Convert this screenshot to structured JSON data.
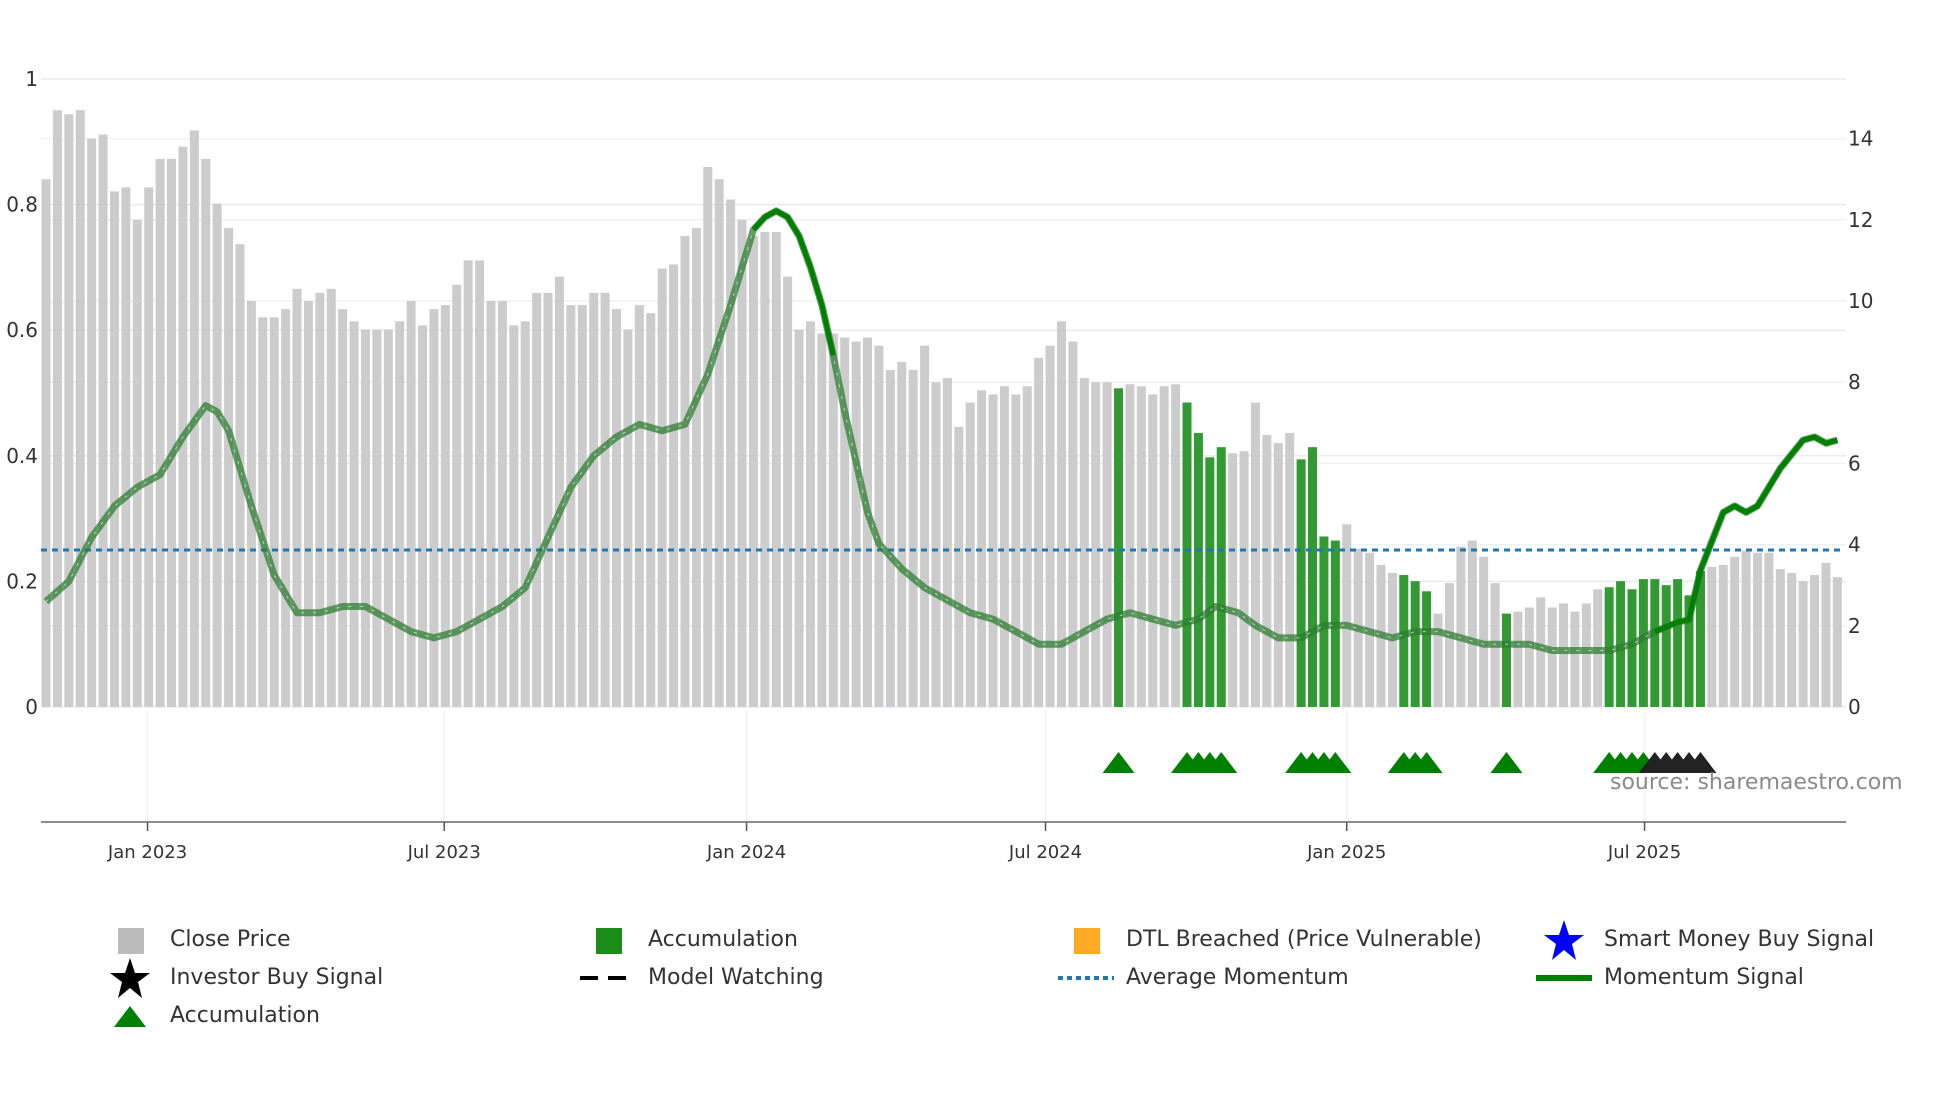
{
  "chart_data": {
    "type": "bar",
    "title": "",
    "source_note": "source: sharemaestro.com",
    "left_axis": {
      "range": [
        0,
        1
      ],
      "ticks": [
        "0",
        "0.2",
        "0.4",
        "0.6",
        "0.8",
        "1"
      ],
      "tick_values": [
        0,
        0.2,
        0.4,
        0.6,
        0.8,
        1
      ]
    },
    "right_axis": {
      "range": [
        0,
        14
      ],
      "ticks": [
        "0",
        "2",
        "4",
        "6",
        "8",
        "10",
        "12",
        "14"
      ],
      "tick_values": [
        0,
        2,
        4,
        6,
        8,
        10,
        12,
        14
      ]
    },
    "x_axis": {
      "ticks": [
        "Jan 2023",
        "Jul 2023",
        "Jan 2024",
        "Jul 2024",
        "Jan 2025",
        "Jul 2025"
      ],
      "tick_week_index": [
        8.9,
        34.9,
        61.4,
        87.6,
        114.0,
        140.1
      ],
      "grid": true
    },
    "close_price": [
      13.0,
      14.7,
      14.6,
      14.7,
      14.0,
      14.1,
      12.7,
      12.8,
      12.0,
      12.8,
      13.5,
      13.5,
      13.8,
      14.2,
      13.5,
      12.4,
      11.8,
      11.4,
      10.0,
      9.6,
      9.6,
      9.8,
      10.3,
      10.0,
      10.2,
      10.3,
      9.8,
      9.5,
      9.3,
      9.3,
      9.3,
      9.5,
      10.0,
      9.4,
      9.8,
      9.9,
      10.4,
      11.0,
      11.0,
      10.0,
      10.0,
      9.4,
      9.5,
      10.2,
      10.2,
      10.6,
      9.9,
      9.9,
      10.2,
      10.2,
      9.8,
      9.3,
      9.9,
      9.7,
      10.8,
      10.9,
      11.6,
      11.8,
      13.3,
      13.0,
      12.5,
      12.0,
      11.6,
      11.7,
      11.7,
      10.6,
      9.3,
      9.5,
      9.2,
      9.2,
      9.1,
      9.0,
      9.1,
      8.9,
      8.3,
      8.5,
      8.3,
      8.9,
      8.0,
      8.1,
      6.9,
      7.5,
      7.8,
      7.7,
      7.9,
      7.7,
      7.9,
      8.6,
      8.9,
      9.5,
      9.0,
      8.1,
      8.0,
      8.0,
      7.85,
      7.95,
      7.9,
      7.7,
      7.9,
      7.95,
      7.5,
      6.75,
      6.15,
      6.4,
      6.25,
      6.3,
      7.5,
      6.7,
      6.5,
      6.75,
      6.1,
      6.4,
      4.2,
      4.1,
      4.5,
      3.9,
      3.8,
      3.5,
      3.3,
      3.25,
      3.1,
      2.85,
      2.3,
      3.05,
      3.95,
      4.1,
      3.7,
      3.05,
      2.3,
      2.35,
      2.45,
      2.7,
      2.45,
      2.55,
      2.35,
      2.55,
      2.9,
      2.95,
      3.1,
      2.9,
      3.15,
      3.15,
      3.0,
      3.15,
      2.75,
      3.35,
      3.45,
      3.5,
      3.7,
      3.85,
      3.8,
      3.8,
      3.4,
      3.3,
      3.1,
      3.25,
      3.55,
      3.2
    ],
    "accumulation_weeks": [
      94,
      100,
      101,
      102,
      103,
      110,
      111,
      112,
      113,
      119,
      120,
      121,
      128,
      137,
      138,
      139,
      140,
      141,
      142,
      143,
      144,
      145
    ],
    "accumulation_markers": [
      94,
      100,
      101,
      102,
      103,
      110,
      111,
      112,
      113,
      119,
      120,
      121,
      128,
      137,
      138,
      139,
      140
    ],
    "investor_buy_markers": [
      141,
      142,
      143,
      144,
      145
    ],
    "momentum_signal": [
      [
        0,
        0.168
      ],
      [
        2,
        0.2
      ],
      [
        4,
        0.27
      ],
      [
        6,
        0.32
      ],
      [
        8,
        0.35
      ],
      [
        10,
        0.37
      ],
      [
        12,
        0.43
      ],
      [
        14,
        0.48
      ],
      [
        15,
        0.47
      ],
      [
        16,
        0.44
      ],
      [
        18,
        0.32
      ],
      [
        20,
        0.21
      ],
      [
        22,
        0.15
      ],
      [
        24,
        0.15
      ],
      [
        26,
        0.16
      ],
      [
        28,
        0.16
      ],
      [
        30,
        0.14
      ],
      [
        32,
        0.12
      ],
      [
        34,
        0.11
      ],
      [
        36,
        0.12
      ],
      [
        38,
        0.14
      ],
      [
        40,
        0.16
      ],
      [
        42,
        0.19
      ],
      [
        44,
        0.27
      ],
      [
        46,
        0.35
      ],
      [
        48,
        0.4
      ],
      [
        50,
        0.43
      ],
      [
        52,
        0.45
      ],
      [
        54,
        0.44
      ],
      [
        56,
        0.45
      ],
      [
        58,
        0.53
      ],
      [
        60,
        0.64
      ],
      [
        62,
        0.76
      ],
      [
        63,
        0.78
      ],
      [
        64,
        0.79
      ],
      [
        65,
        0.78
      ],
      [
        66,
        0.75
      ],
      [
        67,
        0.7
      ],
      [
        68,
        0.64
      ],
      [
        69,
        0.56
      ],
      [
        70,
        0.47
      ],
      [
        71,
        0.39
      ],
      [
        72,
        0.31
      ],
      [
        73,
        0.26
      ],
      [
        75,
        0.22
      ],
      [
        77,
        0.19
      ],
      [
        79,
        0.17
      ],
      [
        81,
        0.15
      ],
      [
        83,
        0.14
      ],
      [
        85,
        0.12
      ],
      [
        87,
        0.1
      ],
      [
        89,
        0.1
      ],
      [
        91,
        0.12
      ],
      [
        93,
        0.14
      ],
      [
        95,
        0.15
      ],
      [
        97,
        0.14
      ],
      [
        99,
        0.13
      ],
      [
        101,
        0.14
      ],
      [
        102.5,
        0.16
      ],
      [
        104.5,
        0.15
      ],
      [
        106,
        0.13
      ],
      [
        108,
        0.11
      ],
      [
        110,
        0.11
      ],
      [
        112,
        0.13
      ],
      [
        114,
        0.13
      ],
      [
        116,
        0.12
      ],
      [
        118,
        0.11
      ],
      [
        120,
        0.12
      ],
      [
        122,
        0.12
      ],
      [
        124,
        0.11
      ],
      [
        126,
        0.1
      ],
      [
        128,
        0.1
      ],
      [
        130,
        0.1
      ],
      [
        132,
        0.09
      ],
      [
        134,
        0.09
      ],
      [
        135,
        0.09
      ],
      [
        137,
        0.09
      ],
      [
        139,
        0.1
      ],
      [
        141,
        0.12
      ],
      [
        143,
        0.135
      ],
      [
        144,
        0.139
      ],
      [
        145,
        0.218
      ],
      [
        147,
        0.31
      ],
      [
        148,
        0.32
      ],
      [
        149,
        0.31
      ],
      [
        150,
        0.32
      ],
      [
        152,
        0.38
      ],
      [
        154,
        0.425
      ],
      [
        155,
        0.43
      ],
      [
        156,
        0.42
      ],
      [
        157,
        0.425
      ]
    ],
    "momentum_highlight_ranges": [
      [
        61,
        69
      ],
      [
        141,
        157
      ]
    ],
    "average_momentum": 0.25,
    "colors": {
      "close": "#cccccc",
      "accumulation": "#339933",
      "momentum": "#008000",
      "average": "#1f77b4",
      "triangle": "#008000",
      "investor": "#000000",
      "dtl": "#ffaa22",
      "smart_money": "#0000ff"
    },
    "legend": [
      {
        "label": "Close Price",
        "icon": "gray-square-icon"
      },
      {
        "label": "Accumulation",
        "icon": "green-square-icon"
      },
      {
        "label": "DTL Breached (Price Vulnerable)",
        "icon": "orange-square-icon"
      },
      {
        "label": "Smart Money Buy Signal",
        "icon": "blue-star-icon"
      },
      {
        "label": "Investor Buy Signal",
        "icon": "black-star-icon"
      },
      {
        "label": "Model Watching",
        "icon": "dashed-line-icon"
      },
      {
        "label": "Average Momentum",
        "icon": "dotted-line-icon"
      },
      {
        "label": "Momentum Signal",
        "icon": "green-line-icon"
      },
      {
        "label": "Accumulation",
        "icon": "green-triangle-icon"
      }
    ]
  }
}
